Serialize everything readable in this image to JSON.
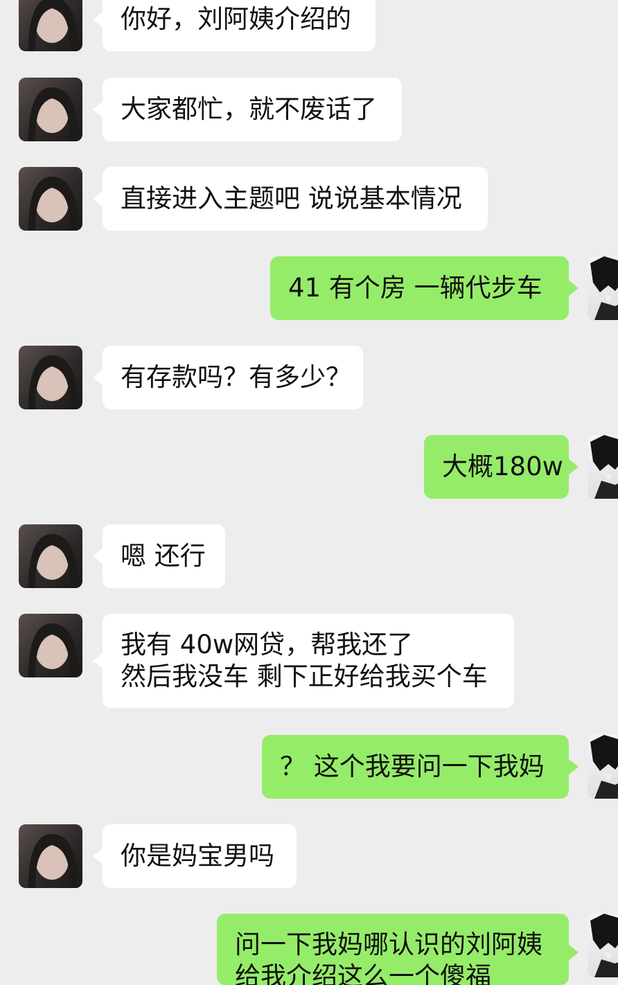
{
  "colors": {
    "background": "#ededed",
    "incoming_bubble": "#ffffff",
    "outgoing_bubble": "#95ec69"
  },
  "messages": [
    {
      "side": "left",
      "lines": [
        "你好，刘阿姨介绍的"
      ]
    },
    {
      "side": "left",
      "lines": [
        "大家都忙，就不废话了"
      ]
    },
    {
      "side": "left",
      "lines": [
        "直接进入主题吧 说说基本情况"
      ]
    },
    {
      "side": "right",
      "lines": [
        "41  有个房 一辆代步车"
      ]
    },
    {
      "side": "left",
      "lines": [
        "有存款吗？有多少？"
      ]
    },
    {
      "side": "right",
      "lines": [
        "大概180w"
      ]
    },
    {
      "side": "left",
      "lines": [
        "嗯 还行"
      ]
    },
    {
      "side": "left",
      "lines": [
        "我有 40w网贷，帮我还了",
        "然后我没车 剩下正好给我买个车"
      ]
    },
    {
      "side": "right",
      "lines": [
        "？ 这个我要问一下我妈"
      ]
    },
    {
      "side": "left",
      "lines": [
        "你是妈宝男吗"
      ]
    },
    {
      "side": "right",
      "lines": [
        "问一下我妈哪认识的刘阿姨",
        "给我介绍这么一个傻福"
      ]
    }
  ]
}
